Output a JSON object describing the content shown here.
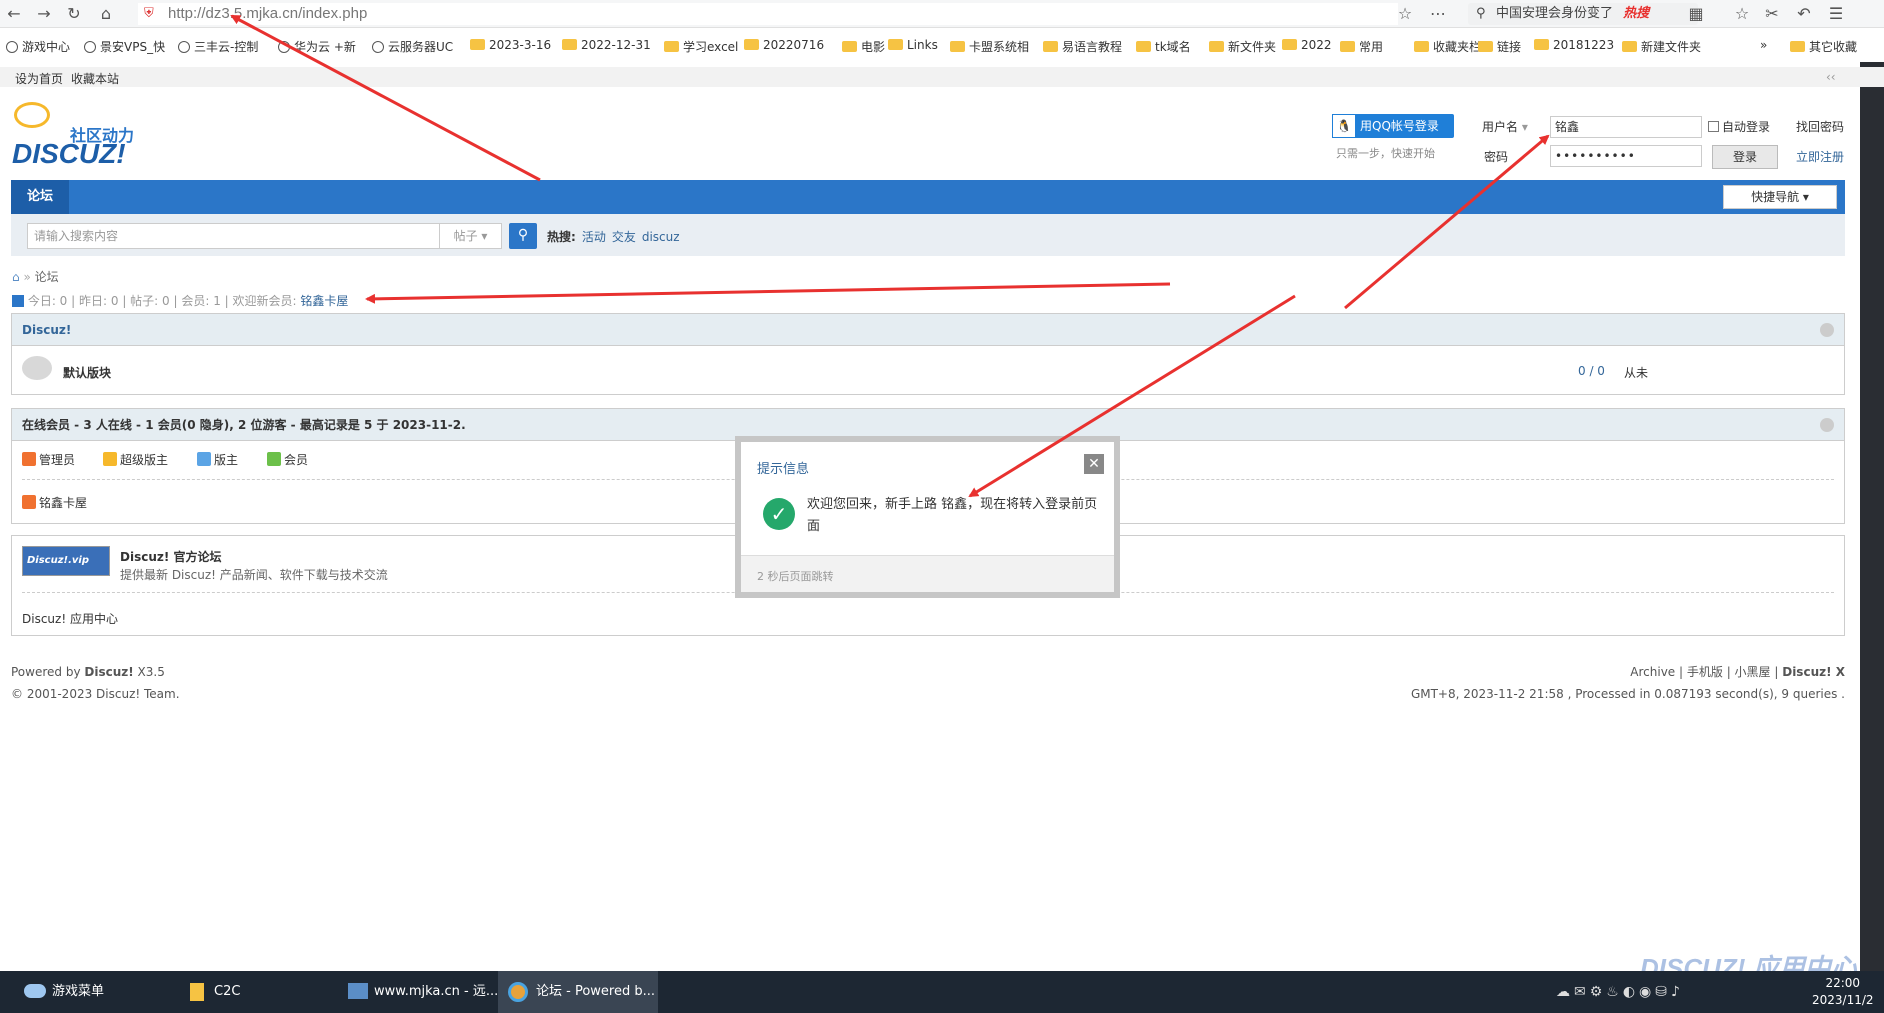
{
  "browser": {
    "url": "http://dz3.5.mjka.cn/index.php",
    "search_hot_text": "中国安理会身份变了",
    "hot_badge": "热搜"
  },
  "bookmarks": [
    {
      "label": "游戏中心",
      "icon": "globe-icon"
    },
    {
      "label": "景安VPS_快",
      "icon": "globe-icon"
    },
    {
      "label": "三丰云-控制",
      "icon": "globe-icon"
    },
    {
      "label": "华为云 +新",
      "icon": "globe-icon"
    },
    {
      "label": "云服务器UC",
      "icon": "globe-icon"
    },
    {
      "label": "2023-3-16",
      "icon": "folder-icon"
    },
    {
      "label": "2022-12-31",
      "icon": "folder-icon"
    },
    {
      "label": "学习excel",
      "icon": "folder-icon"
    },
    {
      "label": "20220716",
      "icon": "folder-icon"
    },
    {
      "label": "电影",
      "icon": "folder-icon"
    },
    {
      "label": "Links",
      "icon": "folder-icon"
    },
    {
      "label": "卡盟系统相",
      "icon": "folder-icon"
    },
    {
      "label": "易语言教程",
      "icon": "folder-icon"
    },
    {
      "label": "tk域名",
      "icon": "folder-icon"
    },
    {
      "label": "新文件夹",
      "icon": "folder-icon"
    },
    {
      "label": "2022",
      "icon": "folder-icon"
    },
    {
      "label": "常用",
      "icon": "folder-icon"
    },
    {
      "label": "收藏夹栏",
      "icon": "folder-icon"
    },
    {
      "label": "链接",
      "icon": "folder-icon"
    },
    {
      "label": "20181223",
      "icon": "folder-icon"
    },
    {
      "label": "新建文件夹",
      "icon": "folder-icon"
    },
    {
      "label": "»",
      "icon": ""
    },
    {
      "label": "其它收藏",
      "icon": "folder-icon"
    }
  ],
  "topnav": {
    "set_home": "设为首页",
    "favorite": "收藏本站"
  },
  "logo": {
    "cn": "社区动力",
    "en": "DISCUZ!"
  },
  "login": {
    "qq_button": "用QQ帐号登录",
    "qq_hint": "只需一步，快速开始",
    "username_label": "用户名",
    "username_value": "铭鑫",
    "password_label": "密码",
    "password_value": "••••••••••",
    "auto_login": "自动登录",
    "submit": "登录",
    "find_password": "找回密码",
    "register": "立即注册"
  },
  "nav": {
    "forum": "论坛",
    "quick_nav": "快捷导航"
  },
  "search": {
    "placeholder": "请输入搜索内容",
    "type": "帖子",
    "hot_label": "热搜:",
    "hot_words": [
      "活动",
      "交友",
      "discuz"
    ]
  },
  "breadcrumb": {
    "current": "论坛"
  },
  "stats": {
    "today": "今日: 0",
    "yesterday": "昨日: 0",
    "posts": "帖子: 0",
    "members": "会员: 1",
    "welcome_label": "欢迎新会员: ",
    "newest_member": "铭鑫卡屋"
  },
  "forum_group": {
    "title": "Discuz!",
    "board": "默认版块",
    "counts": "0 / 0",
    "last_post": "从未"
  },
  "online": {
    "title": "在线会员 - 3 人在线 - 1 会员(0 隐身), 2 位游客 - 最高记录是 5 于 2023-11-2.",
    "roles": [
      "管理员",
      "超级版主",
      "版主",
      "会员"
    ],
    "members": [
      "铭鑫卡屋"
    ]
  },
  "links": {
    "badge": "Discuz!.vip",
    "title": "Discuz! 官方论坛",
    "desc": "提供最新 Discuz! 产品新闻、软件下载与技术交流",
    "app_center": "Discuz! 应用中心"
  },
  "popup": {
    "title": "提示信息",
    "message": "欢迎您回来，新手上路 铭鑫，现在将转入登录前页面",
    "redirect": "2 秒后页面跳转"
  },
  "footer": {
    "powered_prefix": "Powered by ",
    "powered_brand": "Discuz!",
    "powered_version": " X3.5",
    "copyright": "© 2001-2023 Discuz! Team.",
    "links": [
      "Archive",
      "手机版",
      "小黑屋"
    ],
    "brand": "Discuz! X",
    "runtime": "GMT+8, 2023-11-2 21:58 , Processed in 0.087193 second(s), 9 queries ."
  },
  "taskbar": {
    "items": [
      "游戏菜单",
      "C2C",
      "www.mjka.cn - 远...",
      "论坛 - Powered b..."
    ],
    "time": "22:00",
    "date": "2023/11/2"
  },
  "watermark": "DISCUZ! 应用中心",
  "colors": {
    "nav_blue": "#2b76c8",
    "annotation_red": "#e8312f",
    "success_green": "#25a86b"
  }
}
